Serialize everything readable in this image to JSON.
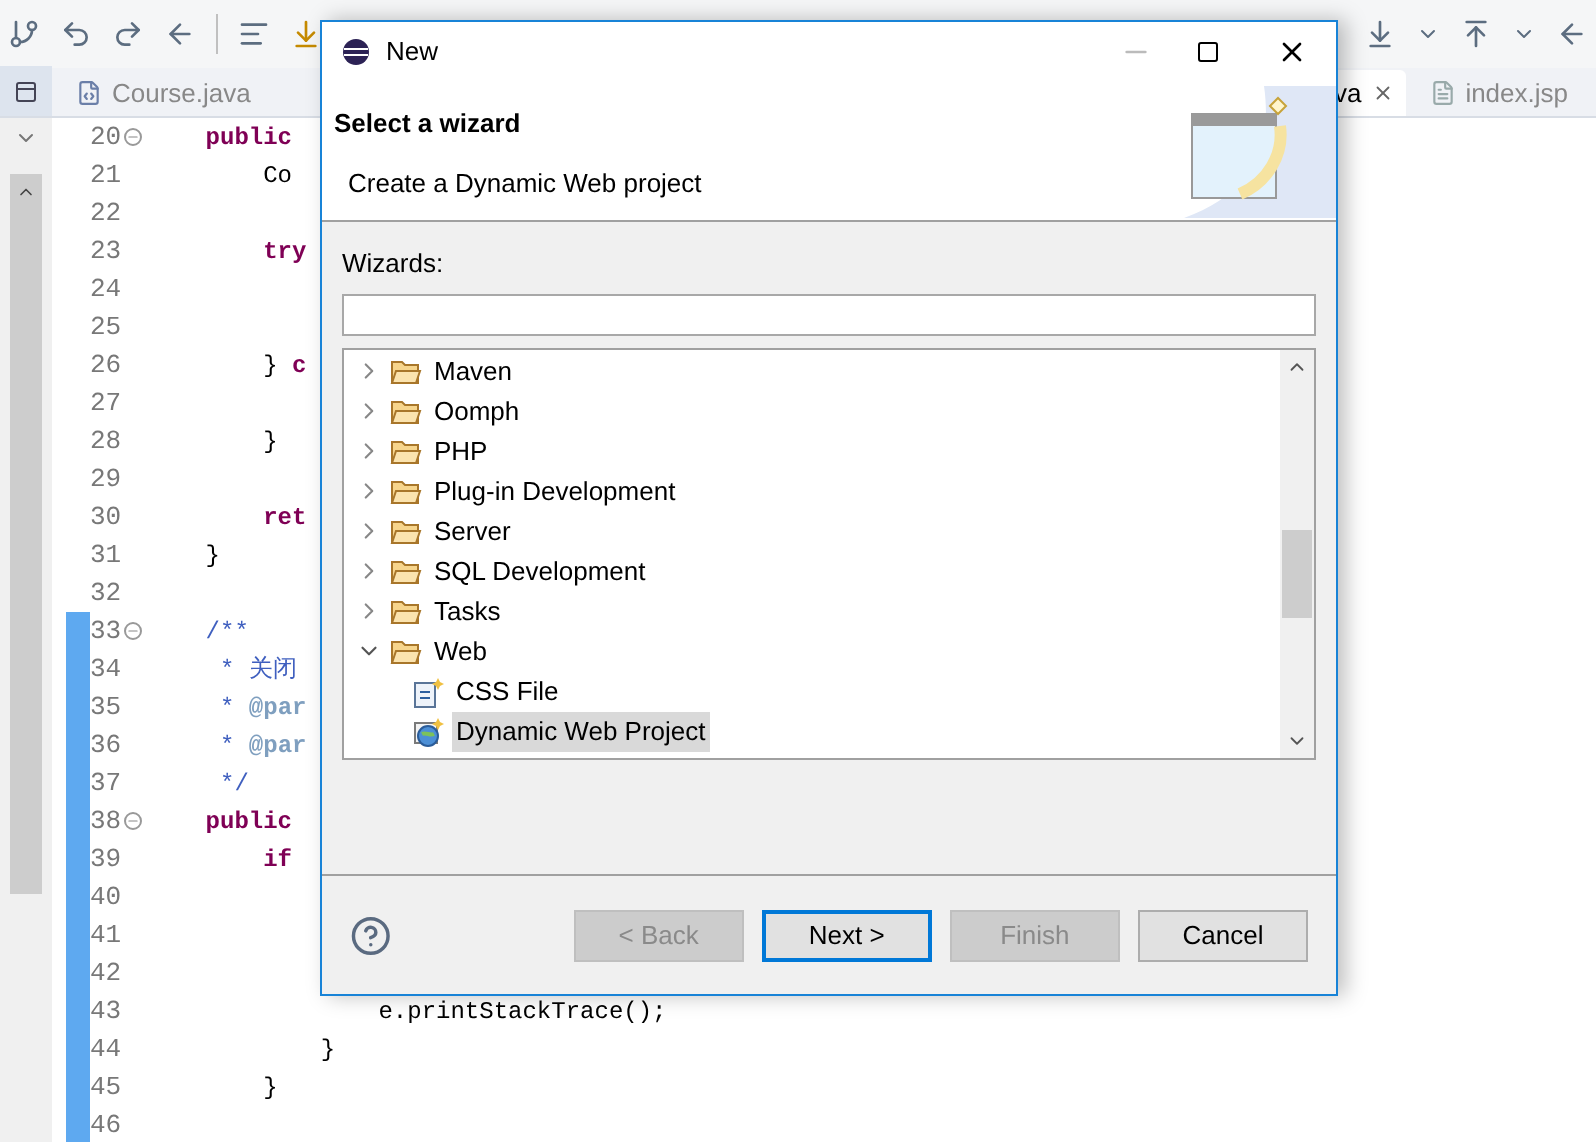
{
  "editor_tabs": [
    {
      "label": "Course.java",
      "selected": false,
      "closable": false
    },
    {
      "label": "va",
      "selected": true,
      "closable": true
    },
    {
      "label": "index.jsp",
      "selected": false,
      "closable": false
    }
  ],
  "code_lines": [
    {
      "number": "20",
      "fold": true,
      "changed": false,
      "tokens": [
        {
          "kind": "keyword",
          "text": "    public"
        }
      ]
    },
    {
      "number": "21",
      "fold": false,
      "changed": false,
      "tokens": [
        {
          "kind": "plain",
          "text": "        Co"
        }
      ]
    },
    {
      "number": "22",
      "fold": false,
      "changed": false
    },
    {
      "number": "23",
      "fold": false,
      "changed": false,
      "tokens": [
        {
          "kind": "keyword",
          "text": "        try"
        }
      ]
    },
    {
      "number": "24",
      "fold": false,
      "changed": false
    },
    {
      "number": "25",
      "fold": false,
      "changed": false
    },
    {
      "number": "26",
      "fold": false,
      "changed": false,
      "tokens": [
        {
          "kind": "plain",
          "text": "        } "
        },
        {
          "kind": "keyword",
          "text": "c"
        }
      ]
    },
    {
      "number": "27",
      "fold": false,
      "changed": false
    },
    {
      "number": "28",
      "fold": false,
      "changed": false,
      "tokens": [
        {
          "kind": "plain",
          "text": "        }"
        }
      ]
    },
    {
      "number": "29",
      "fold": false,
      "changed": false
    },
    {
      "number": "30",
      "fold": false,
      "changed": false,
      "tokens": [
        {
          "kind": "keyword",
          "text": "        ret"
        }
      ]
    },
    {
      "number": "31",
      "fold": false,
      "changed": false,
      "tokens": [
        {
          "kind": "plain",
          "text": "    }"
        }
      ]
    },
    {
      "number": "32",
      "fold": false,
      "changed": false
    },
    {
      "number": "33",
      "fold": true,
      "changed": true,
      "tokens": [
        {
          "kind": "comment",
          "text": "    /**"
        }
      ]
    },
    {
      "number": "34",
      "fold": false,
      "changed": true,
      "tokens": [
        {
          "kind": "comment",
          "text": "     * 关闭"
        }
      ]
    },
    {
      "number": "35",
      "fold": false,
      "changed": true,
      "tokens": [
        {
          "kind": "comment",
          "text": "     * "
        },
        {
          "kind": "tag",
          "text": "@par"
        }
      ]
    },
    {
      "number": "36",
      "fold": false,
      "changed": true,
      "tokens": [
        {
          "kind": "comment",
          "text": "     * "
        },
        {
          "kind": "tag",
          "text": "@par"
        }
      ]
    },
    {
      "number": "37",
      "fold": false,
      "changed": true,
      "tokens": [
        {
          "kind": "comment",
          "text": "     */"
        }
      ]
    },
    {
      "number": "38",
      "fold": true,
      "changed": true,
      "tokens": [
        {
          "kind": "keyword",
          "text": "    public"
        }
      ]
    },
    {
      "number": "39",
      "fold": false,
      "changed": true,
      "tokens": [
        {
          "kind": "keyword",
          "text": "        if"
        }
      ]
    },
    {
      "number": "40",
      "fold": false,
      "changed": true
    },
    {
      "number": "41",
      "fold": false,
      "changed": true
    },
    {
      "number": "42",
      "fold": false,
      "changed": true
    },
    {
      "number": "43",
      "fold": false,
      "changed": true,
      "tokens": [
        {
          "kind": "plain",
          "text": "                e.printStackTrace();"
        }
      ]
    },
    {
      "number": "44",
      "fold": false,
      "changed": true,
      "tokens": [
        {
          "kind": "plain",
          "text": "            }"
        }
      ]
    },
    {
      "number": "45",
      "fold": false,
      "changed": true,
      "tokens": [
        {
          "kind": "plain",
          "text": "        }"
        }
      ]
    },
    {
      "number": "46",
      "fold": false,
      "changed": true
    }
  ],
  "dialog": {
    "title": "New",
    "heading": "Select a wizard",
    "description": "Create a Dynamic Web project",
    "filter_label": "Wizards:",
    "wizards": [
      {
        "label": "Maven",
        "expanded": false,
        "selected": false
      },
      {
        "label": "Oomph",
        "expanded": false,
        "selected": false
      },
      {
        "label": "PHP",
        "expanded": false,
        "selected": false
      },
      {
        "label": "Plug-in Development",
        "expanded": false,
        "selected": false
      },
      {
        "label": "Server",
        "expanded": false,
        "selected": false
      },
      {
        "label": "SQL Development",
        "expanded": false,
        "selected": false
      },
      {
        "label": "Tasks",
        "expanded": false,
        "selected": false
      },
      {
        "label": "Web",
        "expanded": true,
        "selected": false,
        "children": [
          {
            "label": "CSS File",
            "kind": "css",
            "selected": false
          },
          {
            "label": "Dynamic Web Project",
            "kind": "project",
            "selected": true
          }
        ]
      }
    ],
    "buttons": [
      {
        "label": "< Back",
        "disabled": true,
        "default": false
      },
      {
        "label": "Next >",
        "disabled": false,
        "default": true
      },
      {
        "label": "Finish",
        "disabled": true,
        "default": false
      },
      {
        "label": "Cancel",
        "disabled": false,
        "default": false
      }
    ]
  }
}
